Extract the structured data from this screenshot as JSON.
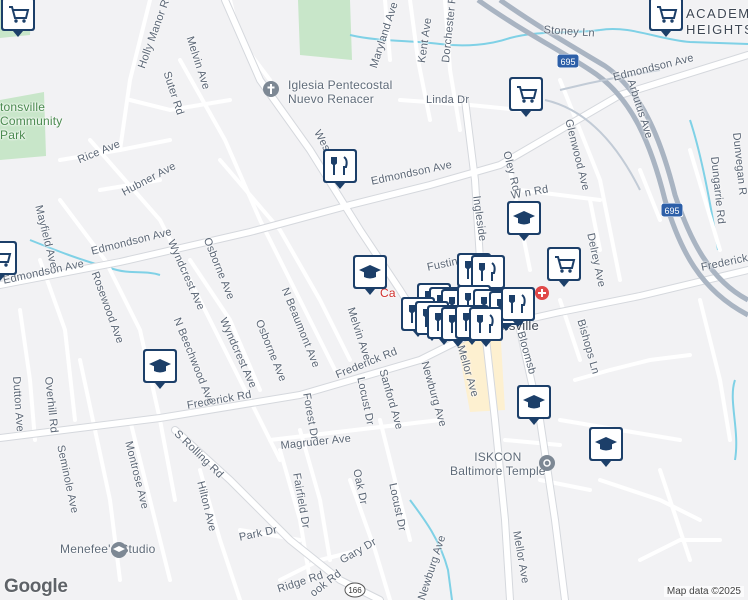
{
  "map": {
    "attribution": "Map data ©2025",
    "logo": "Google",
    "colors": {
      "land": "#f2f2f4",
      "road": "#ffffff",
      "road_outline": "#d5d8dd",
      "highway": "#a9b4c2",
      "water": "#7fd1e6",
      "park": "#c8e6c9",
      "commercial": "#fdf0d0",
      "pin": "#1c3f69"
    }
  },
  "streets": {
    "frederick_rd_w": "Frederick Rd",
    "frederick_rd_c": "Frederick Rd",
    "frederick_rd_e": "Frederick Rd",
    "edmondson_w": "Edmondson Ave",
    "edmondson_c": "Edmondson Ave",
    "edmondson_e": "Edmondson Ave",
    "fusting": "Fusting Ave",
    "rice": "Rice Ave",
    "hubner": "Hubner Ave",
    "holly_manor": "Holly Manor Rd",
    "suter": "Suter Rd",
    "melvin_n": "Melvin Ave",
    "melvin_s": "Melvin Ave",
    "maryland": "Maryland Ave",
    "kent": "Kent Ave",
    "dorchester": "Dorchester Rd",
    "linda": "Linda Dr",
    "stoney": "Stoney Ln",
    "arbutus": "Arbutus Ave",
    "glenwood": "Glenwood Ave",
    "oley": "Oley Rd",
    "ingleside": "Ingleside",
    "dunvegan": "Dunvegan R",
    "dungarrie": "Dungarrie Rd",
    "delrey": "Delrey Ave",
    "bishops": "Bishops Ln",
    "bloomsbury": "Bloomsb",
    "mellor_n": "Mellor Ave",
    "mellor_s": "Mellor Ave",
    "newburg_n": "Newburg Ave",
    "newburg_s": "Newburg Ave",
    "sanford": "Sanford Ave",
    "locust_n": "Locust Dr",
    "locust_s": "Locust Dr",
    "oak": "Oak Dr",
    "gary": "Gary Dr",
    "magruder": "Magruder Ave",
    "forest": "Forest Dr",
    "fairfield": "Fairfield Dr",
    "ridge": "Ridge Rd",
    "rook": "ook Rd",
    "park_dr": "Park Dr",
    "hilton": "Hilton Ave",
    "s_rolling": "S Rolling Rd",
    "montrose": "Montrose Ave",
    "seminole": "Seminole Ave",
    "overhill": "Overhill Rd",
    "dutton": "Dutton Ave",
    "rosewood": "Rosewood Ave",
    "mayfield": "Mayfield Ave",
    "wyndcrest1": "Wyndcrest Ave",
    "wyndcrest2": "Wyndcrest Ave",
    "n_beechwood": "N Beechwood Ave",
    "osborne1": "Osborne Ave",
    "osborne2": "Osborne Ave",
    "n_beaumont": "N Beaumont Ave",
    "western": "Wes",
    "i695_route": "695",
    "route166": "166",
    "frederick_e_edge": "Frederick R",
    "wilkens": "W    n Rd"
  },
  "places": {
    "academy": "ACADEM\nHEIGHTS",
    "park": "tonsville\nCommunity\nPark",
    "church": "Iglesia Pentecostal\nNuevo Renacer",
    "iskcon": "ISKCON\nBaltimore Temple",
    "menefee": "Menefee's Studio",
    "town": "onsville",
    "ca": "Ca"
  },
  "pins": [
    {
      "name": "grocery-pin-topleft",
      "icon": "grocery-cart-icon"
    },
    {
      "name": "grocery-pin-academy",
      "icon": "grocery-cart-icon"
    },
    {
      "name": "grocery-pin-linda",
      "icon": "grocery-cart-icon"
    },
    {
      "name": "restaurant-pin-edmondson",
      "icon": "restaurant-icon"
    },
    {
      "name": "school-pin-wilkens",
      "icon": "school-cap-icon"
    },
    {
      "name": "school-pin-melvin",
      "icon": "school-cap-icon"
    },
    {
      "name": "grocery-pin-delrey",
      "icon": "grocery-cart-icon"
    },
    {
      "name": "grocery-pin-left-edge",
      "icon": "grocery-cart-icon"
    },
    {
      "name": "school-pin-beechwood",
      "icon": "school-cap-icon"
    },
    {
      "name": "school-pin-mellor",
      "icon": "school-cap-icon"
    },
    {
      "name": "school-pin-east",
      "icon": "school-cap-icon"
    },
    {
      "name": "restaurant-cluster-pin",
      "icon": "restaurant-icon"
    }
  ]
}
